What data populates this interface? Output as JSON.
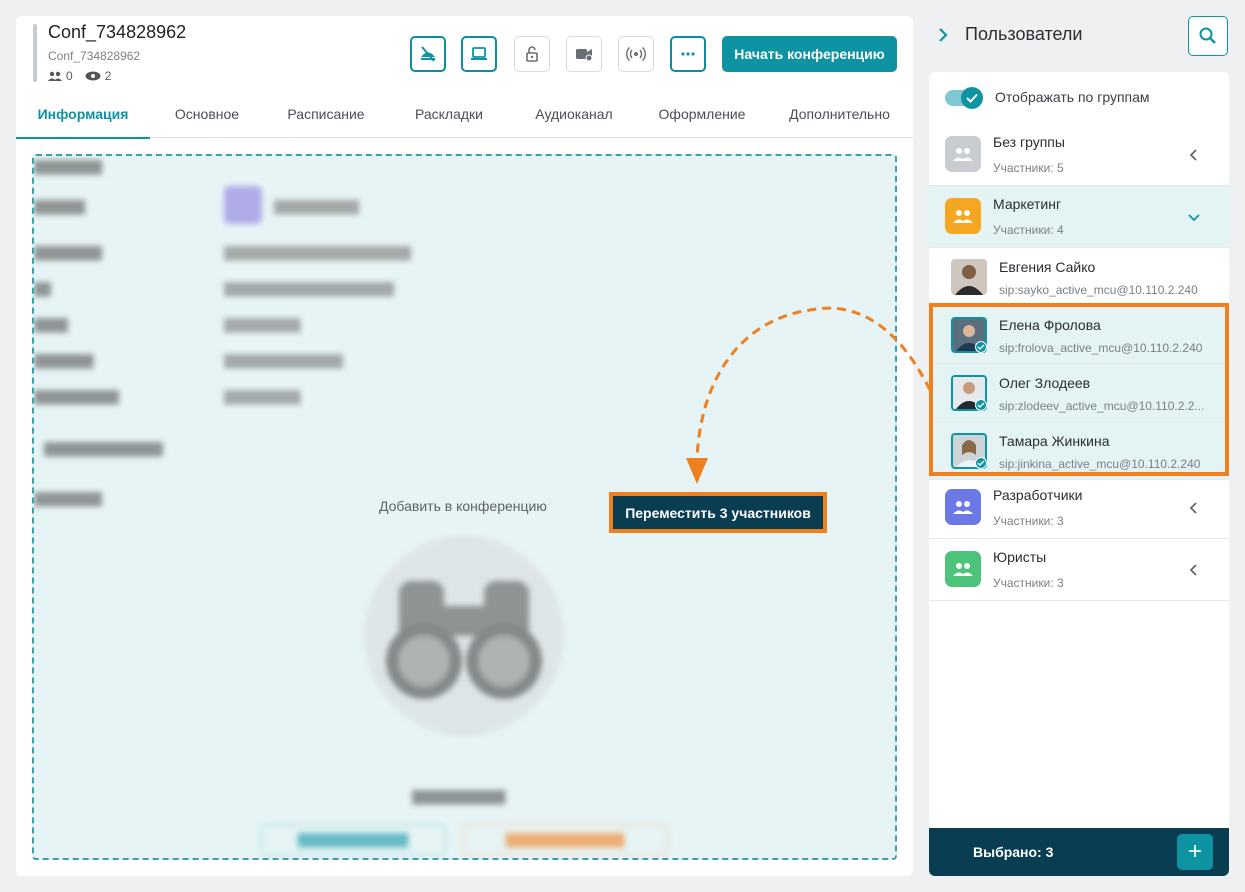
{
  "conference": {
    "title": "Conf_734828962",
    "subtitle": "Conf_734828962",
    "participants_count": "0",
    "viewers_count": "2"
  },
  "toolbar": {
    "icons": [
      "mic-off-icon",
      "laptop-icon",
      "lock-icon",
      "camera-icon",
      "broadcast-icon",
      "more-icon"
    ],
    "start_label": "Начать конференцию"
  },
  "tabs": [
    "Информация",
    "Основное",
    "Расписание",
    "Раскладки",
    "Аудиоканал",
    "Оформление",
    "Дополнительно"
  ],
  "drop_zone": {
    "add_label": "Добавить в конференцию",
    "move_label": "Переместить 3 участников"
  },
  "right_panel": {
    "title": "Пользователи",
    "toggle_label": "Отображать по группам",
    "groups": [
      {
        "name": "Без группы",
        "count": "Участники: 5",
        "color": "#c9ccd0"
      },
      {
        "name": "Маркетинг",
        "count": "Участники: 4",
        "color": "#f5a623"
      },
      {
        "name": "Разработчики",
        "count": "Участники: 3",
        "color": "#6b78e5"
      },
      {
        "name": "Юристы",
        "count": "Участники: 3",
        "color": "#4cc27a"
      }
    ],
    "users": [
      {
        "name": "Евгения Сайко",
        "sip": "sip:sayko_active_mcu@10.110.2.240"
      },
      {
        "name": "Елена Фролова",
        "sip": "sip:frolova_active_mcu@10.110.2.240"
      },
      {
        "name": "Олег Злодеев",
        "sip": "sip:zlodeev_active_mcu@10.110.2.2..."
      },
      {
        "name": "Тамара Жинкина",
        "sip": "sip:jinkina_active_mcu@10.110.2.240"
      }
    ],
    "footer_label": "Выбрано: 3",
    "footer_add": "+"
  },
  "colors": {
    "accent": "#0e93a3",
    "dark": "#093d51",
    "highlight": "#f07f1f"
  }
}
